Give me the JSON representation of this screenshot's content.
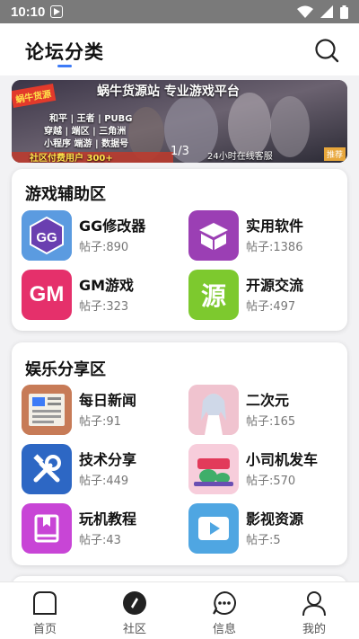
{
  "status": {
    "time": "10:10"
  },
  "header": {
    "title": "论坛分类"
  },
  "banner": {
    "line1": "蜗牛货源站  专业游戏平台",
    "line2": "和平 | 王者 | PUBG",
    "line3": "穿越 | 端区 | 三角洲",
    "line4": "小程序 端游 | 数据号",
    "line5": "社区付费用户 300+",
    "line6": "24小时在线客服",
    "badge_left": "蜗牛货源",
    "badge_right": "推荐",
    "pager": "1/3"
  },
  "sections": [
    {
      "title": "游戏辅助区",
      "items": [
        {
          "name": "GG修改器",
          "count": "帖子:890"
        },
        {
          "name": "实用软件",
          "count": "帖子:1386"
        },
        {
          "name": "GM游戏",
          "count": "帖子:323"
        },
        {
          "name": "开源交流",
          "count": "帖子:497"
        }
      ]
    },
    {
      "title": "娱乐分享区",
      "items": [
        {
          "name": "每日新闻",
          "count": "帖子:91"
        },
        {
          "name": "二次元",
          "count": "帖子:165"
        },
        {
          "name": "技术分享",
          "count": "帖子:449"
        },
        {
          "name": "小司机发车",
          "count": "帖子:570"
        },
        {
          "name": "玩机教程",
          "count": "帖子:43"
        },
        {
          "name": "影视资源",
          "count": "帖子:5"
        }
      ]
    }
  ],
  "icon_text": {
    "gm": "GM",
    "yuan": "源",
    "gg": "GG"
  },
  "tabs": [
    {
      "label": "首页",
      "icon": "home-icon"
    },
    {
      "label": "社区",
      "icon": "compass-icon"
    },
    {
      "label": "信息",
      "icon": "message-icon"
    },
    {
      "label": "我的",
      "icon": "user-icon"
    }
  ],
  "colors": {
    "accent": "#3d7bf7",
    "statusbar": "#7a7a7a"
  }
}
